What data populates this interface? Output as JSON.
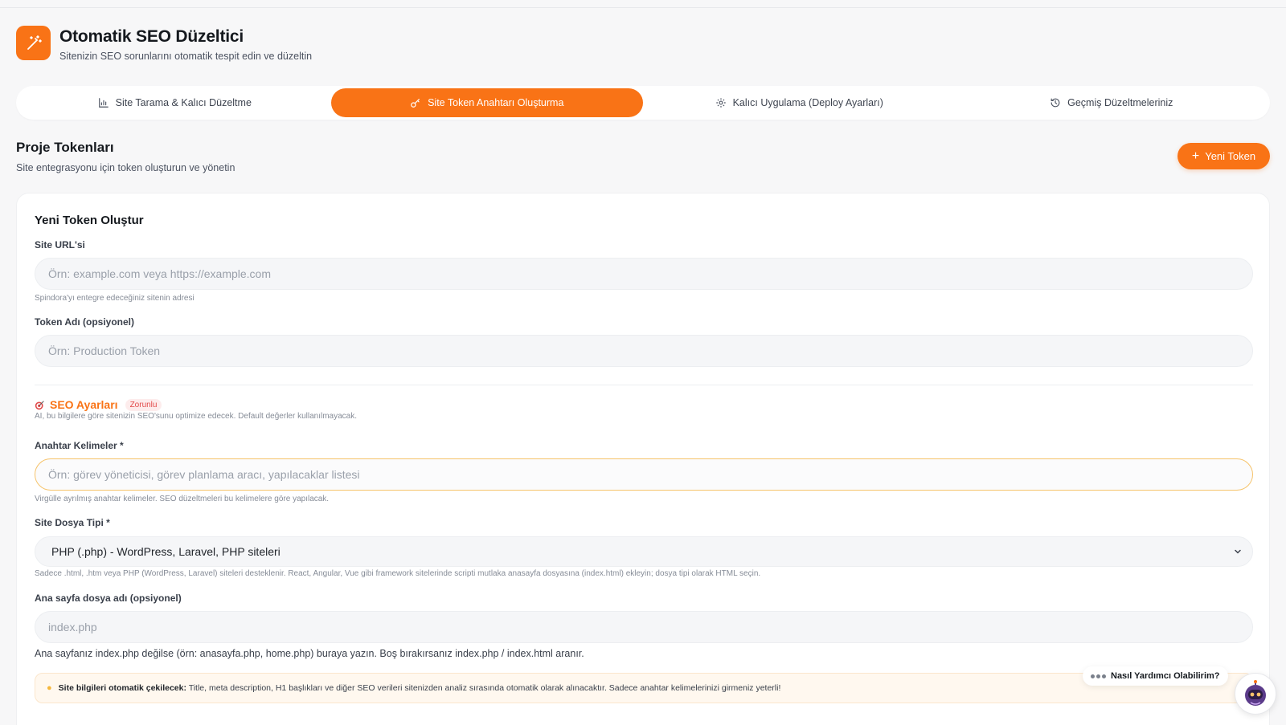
{
  "header": {
    "title": "Otomatik SEO Düzeltici",
    "subtitle": "Sitenizin SEO sorunlarını otomatik tespit edin ve düzeltin"
  },
  "tabs": [
    {
      "label": "Site Tarama & Kalıcı Düzeltme",
      "icon": "bar-chart-icon",
      "active": false
    },
    {
      "label": "Site Token Anahtarı Oluşturma",
      "icon": "key-icon",
      "active": true
    },
    {
      "label": "Kalıcı Uygulama (Deploy Ayarları)",
      "icon": "gear-icon",
      "active": false
    },
    {
      "label": "Geçmiş Düzeltmeleriniz",
      "icon": "history-icon",
      "active": false
    }
  ],
  "section": {
    "title": "Proje Tokenları",
    "subtitle": "Site entegrasyonu için token oluşturun ve yönetin",
    "new_button": "Yeni Token"
  },
  "form": {
    "title": "Yeni Token Oluştur",
    "site_url": {
      "label": "Site URL'si",
      "placeholder": "Örn: example.com veya https://example.com",
      "hint": "Spindora'yı entegre edeceğiniz sitenin adresi"
    },
    "token_name": {
      "label": "Token Adı (opsiyonel)",
      "placeholder": "Örn: Production Token"
    },
    "seo": {
      "title": "SEO Ayarları",
      "badge": "Zorunlu",
      "description": "AI, bu bilgilere göre sitenizin SEO'sunu optimize edecek. Default değerler kullanılmayacak."
    },
    "keywords": {
      "label": "Anahtar Kelimeler *",
      "placeholder": "Örn: görev yöneticisi, görev planlama aracı, yapılacaklar listesi",
      "hint": "Virgülle ayrılmış anahtar kelimeler. SEO düzeltmeleri bu kelimelere göre yapılacak."
    },
    "file_type": {
      "label": "Site Dosya Tipi *",
      "selected": "PHP (.php) - WordPress, Laravel, PHP siteleri",
      "hint": "Sadece .html, .htm veya PHP (WordPress, Laravel) siteleri desteklenir. React, Angular, Vue gibi framework sitelerinde scripti mutlaka anasayfa dosyasına (index.html) ekleyin; dosya tipi olarak HTML seçin."
    },
    "home_file": {
      "label": "Ana sayfa dosya adı (opsiyonel)",
      "placeholder": "index.php",
      "hint": "Ana sayfanız index.php değilse (örn: anasayfa.php, home.php) buraya yazın. Boş bırakırsanız index.php / index.html aranır."
    },
    "note": {
      "bold": "Site bilgileri otomatik çekilecek:",
      "text": " Title, meta description, H1 başlıkları ve diğer SEO verileri sitenizden analiz sırasında otomatik olarak alınacaktır. Sadece anahtar kelimelerinizi girmeniz yeterli!"
    }
  },
  "chat": {
    "label": "Nasıl Yardımcı Olabilirim?"
  },
  "colors": {
    "accent": "#f97316",
    "background": "#f7f7f8",
    "required": "#e24a4a"
  }
}
